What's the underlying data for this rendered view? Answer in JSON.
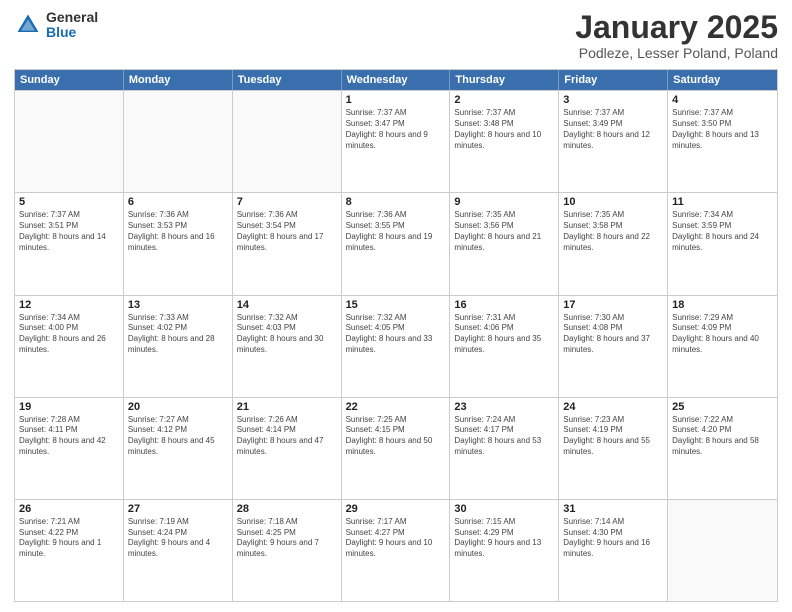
{
  "logo": {
    "general": "General",
    "blue": "Blue"
  },
  "title": "January 2025",
  "subtitle": "Podleze, Lesser Poland, Poland",
  "headers": [
    "Sunday",
    "Monday",
    "Tuesday",
    "Wednesday",
    "Thursday",
    "Friday",
    "Saturday"
  ],
  "rows": [
    [
      {
        "day": "",
        "empty": true
      },
      {
        "day": "",
        "empty": true
      },
      {
        "day": "",
        "empty": true
      },
      {
        "day": "1",
        "sunrise": "Sunrise: 7:37 AM",
        "sunset": "Sunset: 3:47 PM",
        "daylight": "Daylight: 8 hours and 9 minutes."
      },
      {
        "day": "2",
        "sunrise": "Sunrise: 7:37 AM",
        "sunset": "Sunset: 3:48 PM",
        "daylight": "Daylight: 8 hours and 10 minutes."
      },
      {
        "day": "3",
        "sunrise": "Sunrise: 7:37 AM",
        "sunset": "Sunset: 3:49 PM",
        "daylight": "Daylight: 8 hours and 12 minutes."
      },
      {
        "day": "4",
        "sunrise": "Sunrise: 7:37 AM",
        "sunset": "Sunset: 3:50 PM",
        "daylight": "Daylight: 8 hours and 13 minutes."
      }
    ],
    [
      {
        "day": "5",
        "sunrise": "Sunrise: 7:37 AM",
        "sunset": "Sunset: 3:51 PM",
        "daylight": "Daylight: 8 hours and 14 minutes."
      },
      {
        "day": "6",
        "sunrise": "Sunrise: 7:36 AM",
        "sunset": "Sunset: 3:53 PM",
        "daylight": "Daylight: 8 hours and 16 minutes."
      },
      {
        "day": "7",
        "sunrise": "Sunrise: 7:36 AM",
        "sunset": "Sunset: 3:54 PM",
        "daylight": "Daylight: 8 hours and 17 minutes."
      },
      {
        "day": "8",
        "sunrise": "Sunrise: 7:36 AM",
        "sunset": "Sunset: 3:55 PM",
        "daylight": "Daylight: 8 hours and 19 minutes."
      },
      {
        "day": "9",
        "sunrise": "Sunrise: 7:35 AM",
        "sunset": "Sunset: 3:56 PM",
        "daylight": "Daylight: 8 hours and 21 minutes."
      },
      {
        "day": "10",
        "sunrise": "Sunrise: 7:35 AM",
        "sunset": "Sunset: 3:58 PM",
        "daylight": "Daylight: 8 hours and 22 minutes."
      },
      {
        "day": "11",
        "sunrise": "Sunrise: 7:34 AM",
        "sunset": "Sunset: 3:59 PM",
        "daylight": "Daylight: 8 hours and 24 minutes."
      }
    ],
    [
      {
        "day": "12",
        "sunrise": "Sunrise: 7:34 AM",
        "sunset": "Sunset: 4:00 PM",
        "daylight": "Daylight: 8 hours and 26 minutes."
      },
      {
        "day": "13",
        "sunrise": "Sunrise: 7:33 AM",
        "sunset": "Sunset: 4:02 PM",
        "daylight": "Daylight: 8 hours and 28 minutes."
      },
      {
        "day": "14",
        "sunrise": "Sunrise: 7:32 AM",
        "sunset": "Sunset: 4:03 PM",
        "daylight": "Daylight: 8 hours and 30 minutes."
      },
      {
        "day": "15",
        "sunrise": "Sunrise: 7:32 AM",
        "sunset": "Sunset: 4:05 PM",
        "daylight": "Daylight: 8 hours and 33 minutes."
      },
      {
        "day": "16",
        "sunrise": "Sunrise: 7:31 AM",
        "sunset": "Sunset: 4:06 PM",
        "daylight": "Daylight: 8 hours and 35 minutes."
      },
      {
        "day": "17",
        "sunrise": "Sunrise: 7:30 AM",
        "sunset": "Sunset: 4:08 PM",
        "daylight": "Daylight: 8 hours and 37 minutes."
      },
      {
        "day": "18",
        "sunrise": "Sunrise: 7:29 AM",
        "sunset": "Sunset: 4:09 PM",
        "daylight": "Daylight: 8 hours and 40 minutes."
      }
    ],
    [
      {
        "day": "19",
        "sunrise": "Sunrise: 7:28 AM",
        "sunset": "Sunset: 4:11 PM",
        "daylight": "Daylight: 8 hours and 42 minutes."
      },
      {
        "day": "20",
        "sunrise": "Sunrise: 7:27 AM",
        "sunset": "Sunset: 4:12 PM",
        "daylight": "Daylight: 8 hours and 45 minutes."
      },
      {
        "day": "21",
        "sunrise": "Sunrise: 7:26 AM",
        "sunset": "Sunset: 4:14 PM",
        "daylight": "Daylight: 8 hours and 47 minutes."
      },
      {
        "day": "22",
        "sunrise": "Sunrise: 7:25 AM",
        "sunset": "Sunset: 4:15 PM",
        "daylight": "Daylight: 8 hours and 50 minutes."
      },
      {
        "day": "23",
        "sunrise": "Sunrise: 7:24 AM",
        "sunset": "Sunset: 4:17 PM",
        "daylight": "Daylight: 8 hours and 53 minutes."
      },
      {
        "day": "24",
        "sunrise": "Sunrise: 7:23 AM",
        "sunset": "Sunset: 4:19 PM",
        "daylight": "Daylight: 8 hours and 55 minutes."
      },
      {
        "day": "25",
        "sunrise": "Sunrise: 7:22 AM",
        "sunset": "Sunset: 4:20 PM",
        "daylight": "Daylight: 8 hours and 58 minutes."
      }
    ],
    [
      {
        "day": "26",
        "sunrise": "Sunrise: 7:21 AM",
        "sunset": "Sunset: 4:22 PM",
        "daylight": "Daylight: 9 hours and 1 minute."
      },
      {
        "day": "27",
        "sunrise": "Sunrise: 7:19 AM",
        "sunset": "Sunset: 4:24 PM",
        "daylight": "Daylight: 9 hours and 4 minutes."
      },
      {
        "day": "28",
        "sunrise": "Sunrise: 7:18 AM",
        "sunset": "Sunset: 4:25 PM",
        "daylight": "Daylight: 9 hours and 7 minutes."
      },
      {
        "day": "29",
        "sunrise": "Sunrise: 7:17 AM",
        "sunset": "Sunset: 4:27 PM",
        "daylight": "Daylight: 9 hours and 10 minutes."
      },
      {
        "day": "30",
        "sunrise": "Sunrise: 7:15 AM",
        "sunset": "Sunset: 4:29 PM",
        "daylight": "Daylight: 9 hours and 13 minutes."
      },
      {
        "day": "31",
        "sunrise": "Sunrise: 7:14 AM",
        "sunset": "Sunset: 4:30 PM",
        "daylight": "Daylight: 9 hours and 16 minutes."
      },
      {
        "day": "",
        "empty": true
      }
    ]
  ]
}
